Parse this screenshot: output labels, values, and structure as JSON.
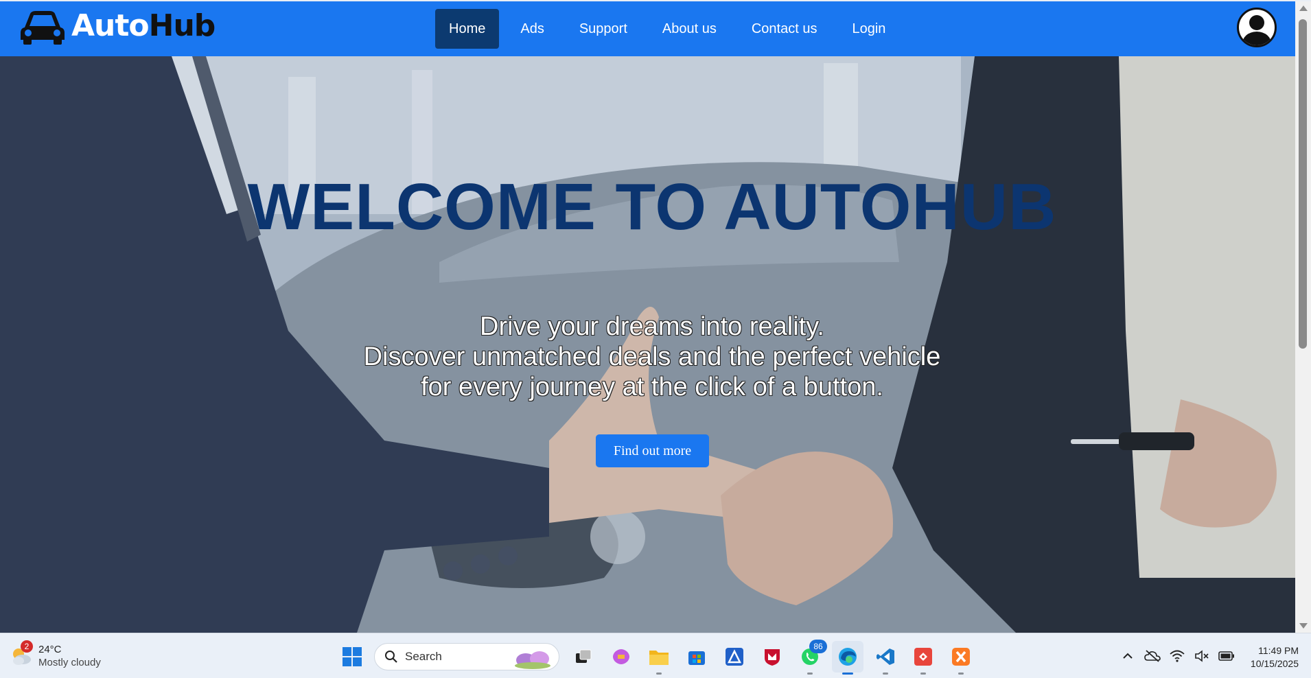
{
  "nav": {
    "logo": {
      "part1": "Auto",
      "part2": "Hub"
    },
    "links": [
      {
        "label": "Home",
        "active": true
      },
      {
        "label": "Ads",
        "active": false
      },
      {
        "label": "Support",
        "active": false
      },
      {
        "label": "About us",
        "active": false
      },
      {
        "label": "Contact us",
        "active": false
      },
      {
        "label": "Login",
        "active": false
      }
    ],
    "avatar_icon": "user-silhouette-icon"
  },
  "hero": {
    "title": "WELCOME TO AUTOHUB",
    "tagline": [
      "Drive your dreams into reality.",
      "Discover unmatched deals and the perfect vehicle",
      "for every journey at the click of a button."
    ],
    "cta_label": "Find out more"
  },
  "taskbar": {
    "weather": {
      "badge": "2",
      "temp": "24°C",
      "condition": "Mostly cloudy"
    },
    "search_placeholder": "Search",
    "apps": [
      {
        "name": "start-icon"
      },
      {
        "name": "task-view-icon"
      },
      {
        "name": "copilot-icon"
      },
      {
        "name": "file-explorer-icon"
      },
      {
        "name": "microsoft-store-icon"
      },
      {
        "name": "app-blue-icon"
      },
      {
        "name": "mcafee-icon"
      },
      {
        "name": "whatsapp-icon",
        "badge": "86"
      },
      {
        "name": "edge-icon",
        "active": true
      },
      {
        "name": "vscode-icon"
      },
      {
        "name": "git-icon"
      },
      {
        "name": "xampp-icon"
      }
    ],
    "tray": [
      "chevron-up-icon",
      "onedrive-off-icon",
      "wifi-icon",
      "volume-muted-icon",
      "battery-icon"
    ],
    "time": "11:49 PM",
    "date": "10/15/2025"
  },
  "colors": {
    "primary": "#1a77f0",
    "nav_active": "#0c3a70",
    "hero_title": "#0c3570"
  }
}
